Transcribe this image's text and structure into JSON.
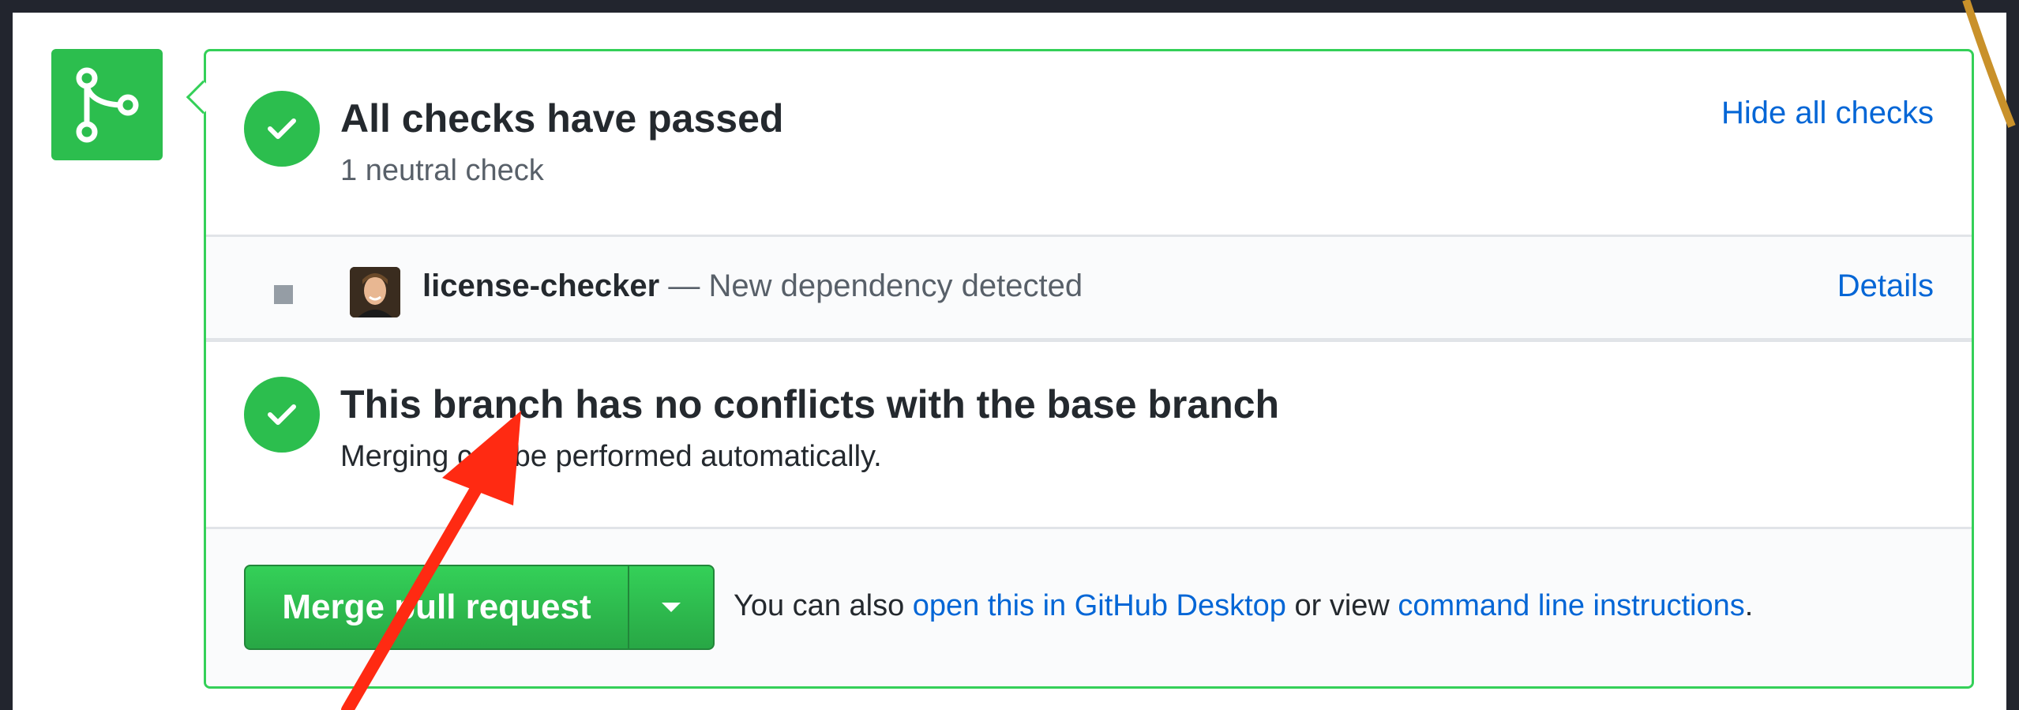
{
  "checks": {
    "title": "All checks have passed",
    "subtitle": "1 neutral check",
    "toggle_link": "Hide all checks"
  },
  "check_item": {
    "name": "license-checker",
    "separator": " — ",
    "description": "New dependency detected",
    "details_link": "Details"
  },
  "branch_status": {
    "title": "This branch has no conflicts with the base branch",
    "subtitle": "Merging can be performed automatically."
  },
  "merge": {
    "button_label": "Merge pull request",
    "note_prefix": "You can also ",
    "desktop_link": "open this in GitHub Desktop",
    "note_middle": " or view ",
    "cli_link": "command line instructions",
    "note_suffix": "."
  },
  "colors": {
    "success_green": "#2cbe4e",
    "border_green": "#34d058",
    "link_blue": "#0366d6",
    "annotation_red": "#ff2a12",
    "backdrop": "#22252e"
  },
  "icons": {
    "merge_status": "git-merge-icon",
    "passed": "check-icon",
    "neutral": "square-icon",
    "dropdown": "caret-down-icon"
  }
}
